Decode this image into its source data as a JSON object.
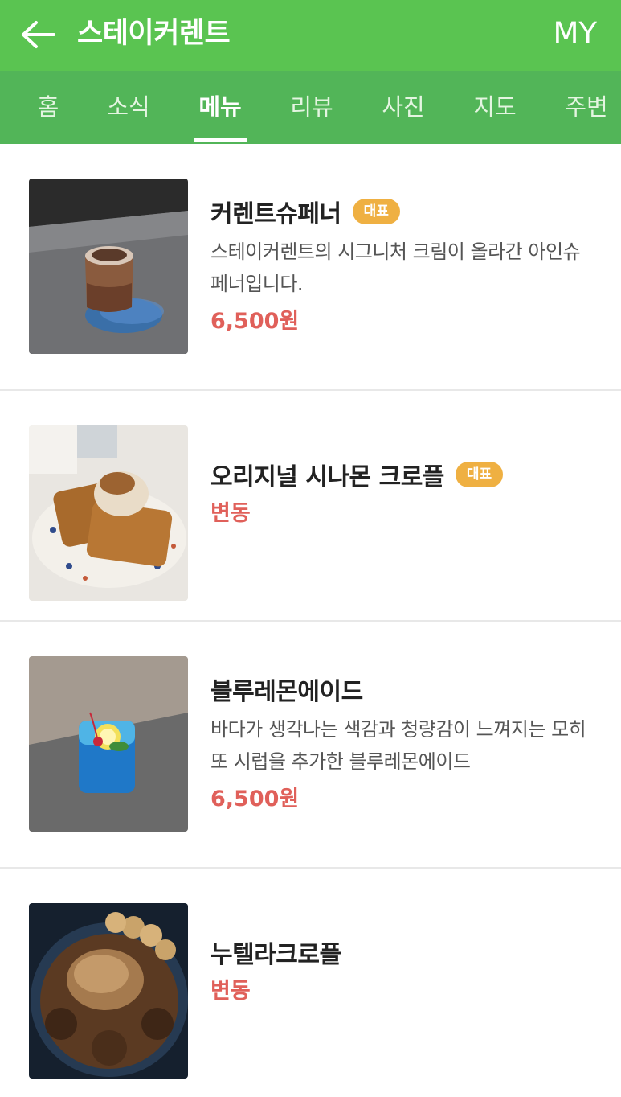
{
  "header": {
    "title": "스테이커렌트",
    "my_label": "MY",
    "back_icon": "arrow-left-icon"
  },
  "tabs": [
    {
      "label": "홈",
      "active": false
    },
    {
      "label": "소식",
      "active": false
    },
    {
      "label": "메뉴",
      "active": true
    },
    {
      "label": "리뷰",
      "active": false
    },
    {
      "label": "사진",
      "active": false
    },
    {
      "label": "지도",
      "active": false
    },
    {
      "label": "주변",
      "active": false
    }
  ],
  "menu": [
    {
      "name": "커렌트슈페너",
      "badge": "대표",
      "desc": "스테이커렌트의 시그니처 크림이 올라간 아인슈페너입니다.",
      "price": "6,500원"
    },
    {
      "name": "오리지널 시나몬 크로플",
      "badge": "대표",
      "desc": "",
      "price": "변동"
    },
    {
      "name": "블루레몬에이드",
      "badge": "",
      "desc": "바다가 생각나는 색감과 청량감이 느껴지는 모히또 시럽을 추가한 블루레몬에이드",
      "price": "6,500원"
    },
    {
      "name": "누텔라크로플",
      "badge": "",
      "desc": "",
      "price": "변동"
    }
  ],
  "colors": {
    "header_bg": "#5ac451",
    "tab_bg": "#52b558",
    "badge": "#efb042",
    "price": "#e0605a"
  }
}
